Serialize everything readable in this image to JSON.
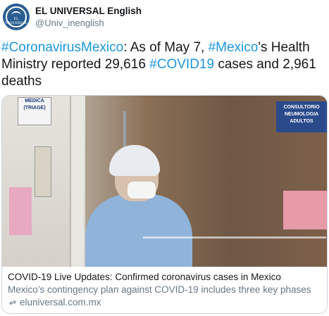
{
  "author": {
    "display_name": "EL UNIVERSAL English",
    "handle": "@Univ_inenglish",
    "avatar_text": "EL UNIVERSAL"
  },
  "tweet": {
    "segments": [
      {
        "text": "#CoronavirusMexico",
        "hashtag": true
      },
      {
        "text": ": As of May 7, ",
        "hashtag": false
      },
      {
        "text": "#Mexico",
        "hashtag": true
      },
      {
        "text": "'s Health Ministry reported 29,616 ",
        "hashtag": false
      },
      {
        "text": "#COVID19",
        "hashtag": true
      },
      {
        "text": " cases and 2,961 deaths",
        "hashtag": false
      }
    ]
  },
  "card": {
    "photo_signs": {
      "left": "MEDICA (TRIAGE)",
      "right": "CONSULTORIO NEUMOLOGIA ADULTOS"
    },
    "title": "COVID-19 Live Updates: Confirmed coronavirus cases in Mexico",
    "description": "Mexico’s contingency plan against COVID-19 includes three key phases",
    "domain": "eluniversal.com.mx"
  },
  "icons": {
    "link": "link-icon",
    "avatar": "avatar-logo"
  },
  "colors": {
    "hashtag": "#1b95e0",
    "text": "#14171a",
    "secondary": "#657786",
    "border": "#ccd6dd"
  }
}
